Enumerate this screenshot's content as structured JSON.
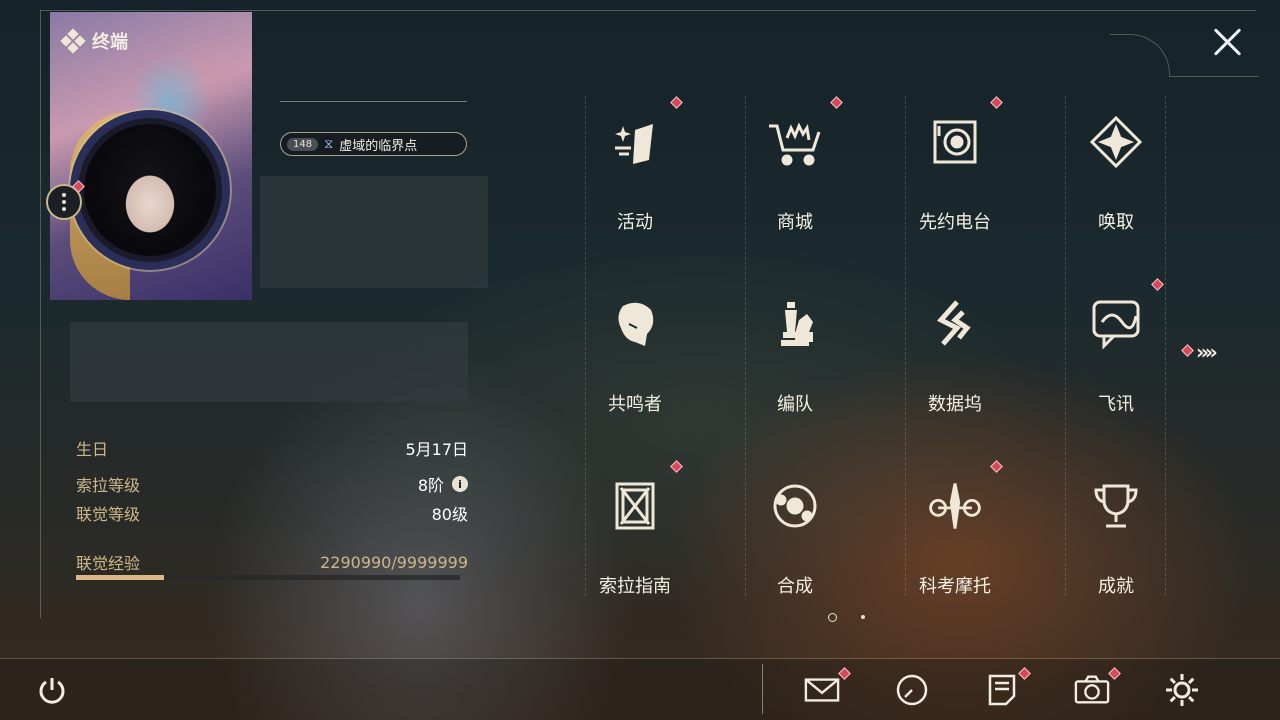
{
  "header": {
    "title": "终端"
  },
  "profile": {
    "badge": {
      "count": "148",
      "label": "虚域的临界点"
    }
  },
  "stats": {
    "birthday": {
      "label": "生日",
      "value": "5月17日"
    },
    "sola_level": {
      "label": "索拉等级",
      "value": "8阶"
    },
    "union_level": {
      "label": "联觉等级",
      "value": "80级"
    },
    "union_exp": {
      "label": "联觉经验",
      "value": "2290990/9999999",
      "progress": 0.23
    }
  },
  "menu": {
    "items": [
      {
        "label": "活动",
        "icon": "sparkle-banner-icon",
        "alert": true
      },
      {
        "label": "商城",
        "icon": "shopping-cart-crown-icon",
        "alert": true
      },
      {
        "label": "先约电台",
        "icon": "radio-speaker-icon",
        "alert": true
      },
      {
        "label": "唤取",
        "icon": "compass-star-icon",
        "alert": false
      },
      {
        "label": "共鸣者",
        "icon": "character-head-icon",
        "alert": false
      },
      {
        "label": "编队",
        "icon": "chess-pieces-icon",
        "alert": false
      },
      {
        "label": "数据坞",
        "icon": "data-dock-icon",
        "alert": false
      },
      {
        "label": "飞讯",
        "icon": "chat-bubble-icon",
        "alert": true
      },
      {
        "label": "索拉指南",
        "icon": "guide-book-icon",
        "alert": true
      },
      {
        "label": "合成",
        "icon": "synthesis-orbit-icon",
        "alert": false
      },
      {
        "label": "科考摩托",
        "icon": "motorbike-icon",
        "alert": true
      },
      {
        "label": "成就",
        "icon": "trophy-icon",
        "alert": false
      }
    ]
  },
  "pagination": {
    "current": 1,
    "total": 2
  },
  "bottom_bar": {
    "items": [
      {
        "icon": "mail-icon",
        "alert": true
      },
      {
        "icon": "clock-icon",
        "alert": false
      },
      {
        "icon": "notice-icon",
        "alert": true
      },
      {
        "icon": "camera-icon",
        "alert": true
      },
      {
        "icon": "settings-gear-icon",
        "alert": false
      }
    ]
  },
  "colors": {
    "accent_gold": "#cdb78a",
    "alert_red": "#d8495a",
    "text_light": "#f5f0e4"
  }
}
